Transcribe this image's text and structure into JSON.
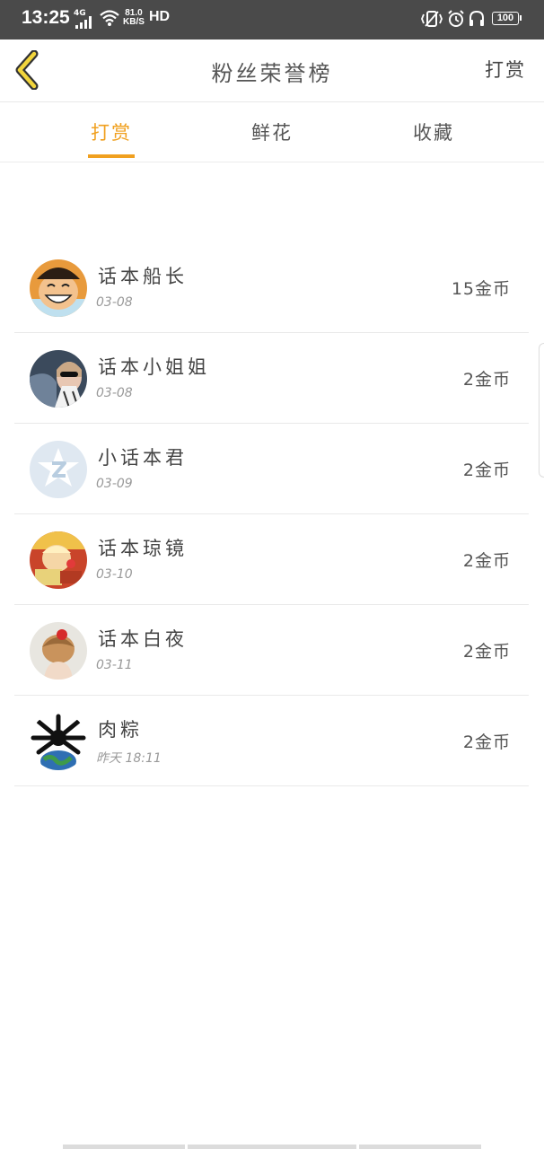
{
  "status_bar": {
    "time": "13:25",
    "network": "4G",
    "speed_value": "81.0",
    "speed_unit": "KB/S",
    "hd": "HD",
    "battery": "100"
  },
  "header": {
    "title": "粉丝荣誉榜",
    "action_label": "打赏"
  },
  "tabs": [
    {
      "label": "打赏",
      "active": true
    },
    {
      "label": "鲜花",
      "active": false
    },
    {
      "label": "收藏",
      "active": false
    }
  ],
  "accent_color": "#f0a020",
  "rows": [
    {
      "name": "话本船长",
      "date": "03-08",
      "coins": "15金币"
    },
    {
      "name": "话本小姐姐",
      "date": "03-08",
      "coins": "2金币"
    },
    {
      "name": "小话本君",
      "date": "03-09",
      "coins": "2金币"
    },
    {
      "name": "话本琼镜",
      "date": "03-10",
      "coins": "2金币"
    },
    {
      "name": "话本白夜",
      "date": "03-11",
      "coins": "2金币"
    },
    {
      "name": "肉粽",
      "date": "昨天 18:11",
      "coins": "2金币"
    }
  ]
}
